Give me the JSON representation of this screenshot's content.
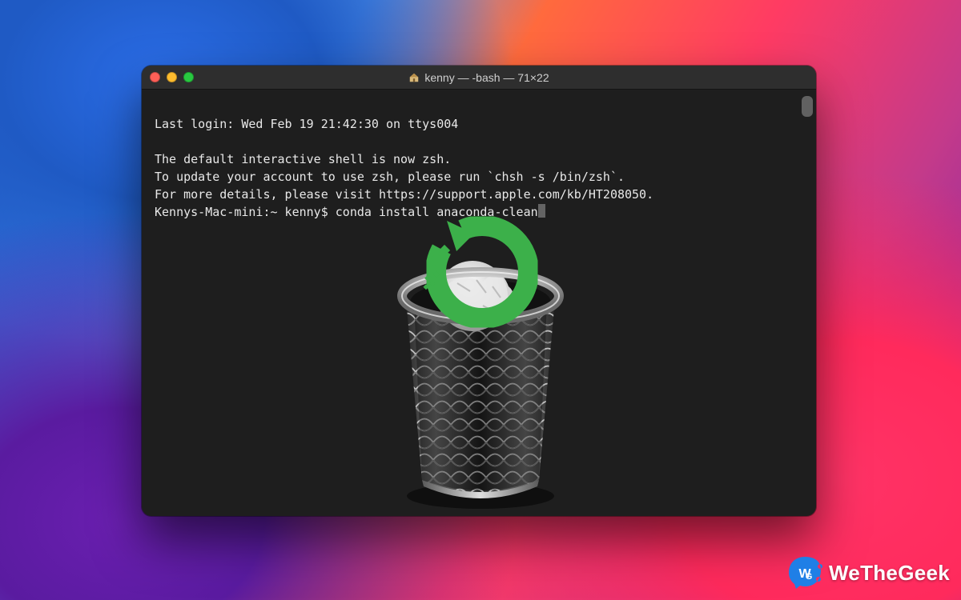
{
  "window": {
    "title": "kenny — -bash — 71×22"
  },
  "terminal": {
    "lines": [
      "Last login: Wed Feb 19 21:42:30 on ttys004",
      "",
      "The default interactive shell is now zsh.",
      "To update your account to use zsh, please run `chsh -s /bin/zsh`.",
      "For more details, please visit https://support.apple.com/kb/HT208050."
    ],
    "prompt": "Kennys-Mac-mini:~ kenny$ ",
    "command": "conda install anaconda-clean"
  },
  "icons": {
    "home": "home-icon",
    "close": "close-icon",
    "minimize": "minimize-icon",
    "zoom": "zoom-icon",
    "trash": "trash-icon",
    "anaconda": "anaconda-logo"
  },
  "watermark": {
    "text": "WeTheGeek",
    "badge": "WG"
  },
  "colors": {
    "terminal_bg": "#1e1e1e",
    "terminal_fg": "#e8e8e8",
    "traffic_red": "#ff5f57",
    "traffic_yellow": "#febc2e",
    "traffic_green": "#28c840",
    "anaconda_green": "#3cb04a",
    "watermark_blue": "#1f7fe6"
  }
}
